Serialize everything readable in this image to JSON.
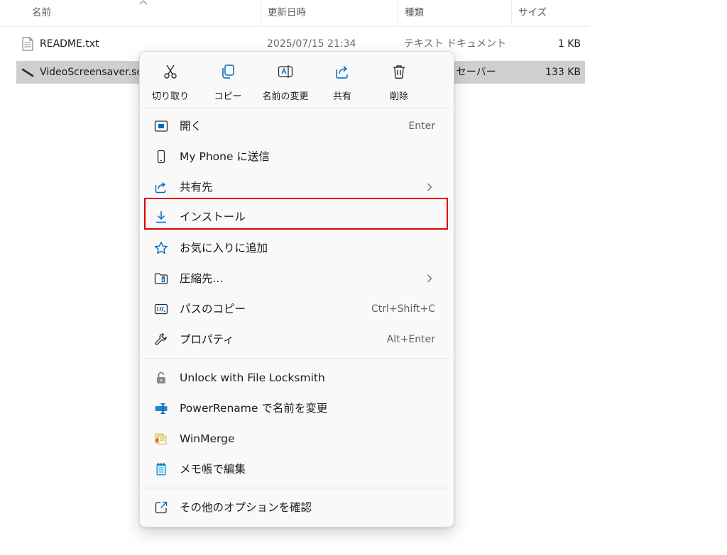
{
  "file_list": {
    "columns": {
      "name": "名前",
      "modified": "更新日時",
      "type": "種類",
      "size": "サイズ"
    },
    "rows": [
      {
        "name": "README.txt",
        "modified": "2025/07/15 21:34",
        "type": "テキスト ドキュメント",
        "size": "1 KB",
        "icon": "text-file-icon",
        "selected": false
      },
      {
        "name": "VideoScreensaver.scr",
        "modified": "",
        "type": "スクリーン セーバー",
        "size": "133 KB",
        "icon": "screensaver-file-icon",
        "selected": true
      }
    ]
  },
  "context_menu": {
    "quick_actions": [
      {
        "id": "cut",
        "label": "切り取り",
        "icon": "scissors-icon"
      },
      {
        "id": "copy",
        "label": "コピー",
        "icon": "copy-icon"
      },
      {
        "id": "rename",
        "label": "名前の変更",
        "icon": "rename-icon"
      },
      {
        "id": "share",
        "label": "共有",
        "icon": "share-icon"
      },
      {
        "id": "delete",
        "label": "削除",
        "icon": "trash-icon"
      }
    ],
    "items": [
      {
        "id": "open",
        "label": "開く",
        "shortcut": "Enter",
        "icon": "open-window-icon"
      },
      {
        "id": "send-to-phone",
        "label": "My Phone に送信",
        "shortcut": "",
        "icon": "phone-icon"
      },
      {
        "id": "share-with",
        "label": "共有先",
        "shortcut": "",
        "icon": "share-icon",
        "submenu": true
      },
      {
        "id": "install",
        "label": "インストール",
        "shortcut": "",
        "icon": "download-icon",
        "highlighted": true
      },
      {
        "id": "add-favorites",
        "label": "お気に入りに追加",
        "shortcut": "",
        "icon": "star-icon"
      },
      {
        "id": "compress-to",
        "label": "圧縮先...",
        "shortcut": "",
        "icon": "zip-folder-icon",
        "submenu": true
      },
      {
        "id": "copy-path",
        "label": "パスのコピー",
        "shortcut": "Ctrl+Shift+C",
        "icon": "copy-path-icon"
      },
      {
        "id": "properties",
        "label": "プロパティ",
        "shortcut": "Alt+Enter",
        "icon": "wrench-icon"
      },
      {
        "id": "locksmith",
        "label": "Unlock with File Locksmith",
        "shortcut": "",
        "icon": "lock-icon"
      },
      {
        "id": "powerrename",
        "label": "PowerRename で名前を変更",
        "shortcut": "",
        "icon": "powerrename-icon"
      },
      {
        "id": "winmerge",
        "label": "WinMerge",
        "shortcut": "",
        "icon": "winmerge-icon"
      },
      {
        "id": "notepad-edit",
        "label": "メモ帳で編集",
        "shortcut": "",
        "icon": "notepad-icon"
      },
      {
        "id": "more-options",
        "label": "その他のオプションを確認",
        "shortcut": "",
        "icon": "external-link-icon"
      }
    ]
  },
  "colors": {
    "accent": "#0067c0",
    "highlight_box": "#e00000",
    "selected_row": "#cfcfcf"
  }
}
